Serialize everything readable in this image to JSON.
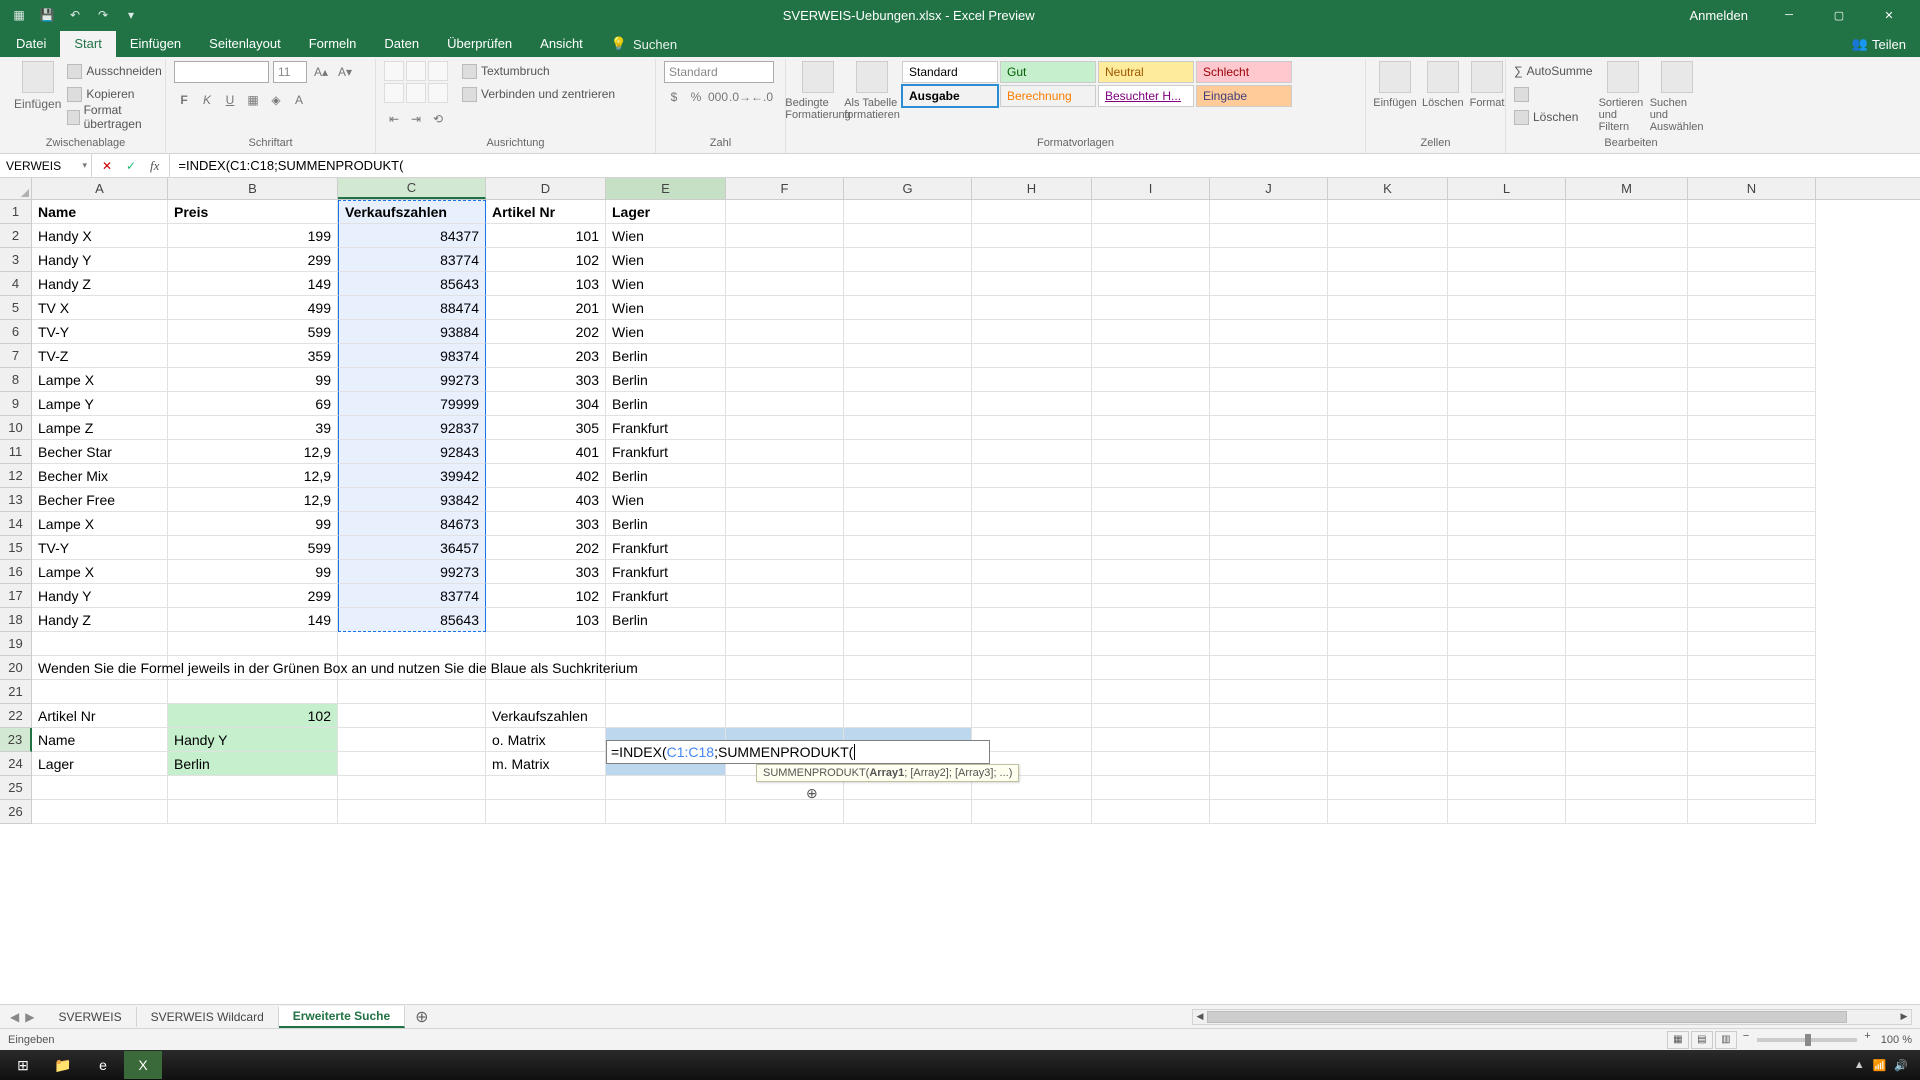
{
  "title": "SVERWEIS-Uebungen.xlsx - Excel Preview",
  "titlebar": {
    "anmelden": "Anmelden",
    "teilen": "Teilen"
  },
  "ribbon_tabs": [
    "Datei",
    "Start",
    "Einfügen",
    "Seitenlayout",
    "Formeln",
    "Daten",
    "Überprüfen",
    "Ansicht"
  ],
  "ribbon_tabs_active": 1,
  "search_label": "Suchen",
  "ribbon": {
    "clipboard": {
      "einfugen": "Einfügen",
      "ausschneiden": "Ausschneiden",
      "kopieren": "Kopieren",
      "format": "Format übertragen",
      "group": "Zwischenablage"
    },
    "font": {
      "name": "",
      "size": "11",
      "group": "Schriftart"
    },
    "align": {
      "textumbruch": "Textumbruch",
      "verbinden": "Verbinden und zentrieren",
      "group": "Ausrichtung"
    },
    "number": {
      "format": "Standard",
      "group": "Zahl"
    },
    "styles": {
      "bedingte": "Bedingte Formatierung",
      "tabelle": "Als Tabelle formatieren",
      "standard": "Standard",
      "gut": "Gut",
      "neutral": "Neutral",
      "schlecht": "Schlecht",
      "ausgabe": "Ausgabe",
      "berechnung": "Berechnung",
      "besuchter": "Besuchter H...",
      "eingabe": "Eingabe",
      "group": "Formatvorlagen"
    },
    "cells": {
      "einfugen": "Einfügen",
      "loschen": "Löschen",
      "format": "Format",
      "group": "Zellen"
    },
    "editing": {
      "autosumme": "AutoSumme",
      "loschen": "Löschen",
      "sortieren": "Sortieren und Filtern",
      "suchen": "Suchen und Auswählen",
      "group": "Bearbeiten"
    }
  },
  "name_box": "VERWEIS",
  "formula_bar": "=INDEX(C1:C18;SUMMENPRODUKT(",
  "columns": [
    "A",
    "B",
    "C",
    "D",
    "E",
    "F",
    "G",
    "H",
    "I",
    "J",
    "K",
    "L",
    "M",
    "N"
  ],
  "rows": [
    {
      "A": "Name",
      "B": "Preis",
      "C": "Verkaufszahlen",
      "D": "Artikel Nr",
      "E": "Lager"
    },
    {
      "A": "Handy X",
      "B": "199",
      "C": "84377",
      "D": "101",
      "E": "Wien"
    },
    {
      "A": "Handy Y",
      "B": "299",
      "C": "83774",
      "D": "102",
      "E": "Wien"
    },
    {
      "A": "Handy Z",
      "B": "149",
      "C": "85643",
      "D": "103",
      "E": "Wien"
    },
    {
      "A": "TV X",
      "B": "499",
      "C": "88474",
      "D": "201",
      "E": "Wien"
    },
    {
      "A": "TV-Y",
      "B": "599",
      "C": "93884",
      "D": "202",
      "E": "Wien"
    },
    {
      "A": "TV-Z",
      "B": "359",
      "C": "98374",
      "D": "203",
      "E": "Berlin"
    },
    {
      "A": "Lampe X",
      "B": "99",
      "C": "99273",
      "D": "303",
      "E": "Berlin"
    },
    {
      "A": "Lampe Y",
      "B": "69",
      "C": "79999",
      "D": "304",
      "E": "Berlin"
    },
    {
      "A": "Lampe Z",
      "B": "39",
      "C": "92837",
      "D": "305",
      "E": "Frankfurt"
    },
    {
      "A": "Becher Star",
      "B": "12,9",
      "C": "92843",
      "D": "401",
      "E": "Frankfurt"
    },
    {
      "A": "Becher Mix",
      "B": "12,9",
      "C": "39942",
      "D": "402",
      "E": "Berlin"
    },
    {
      "A": "Becher Free",
      "B": "12,9",
      "C": "93842",
      "D": "403",
      "E": "Wien"
    },
    {
      "A": "Lampe X",
      "B": "99",
      "C": "84673",
      "D": "303",
      "E": "Berlin"
    },
    {
      "A": "TV-Y",
      "B": "599",
      "C": "36457",
      "D": "202",
      "E": "Frankfurt"
    },
    {
      "A": "Lampe X",
      "B": "99",
      "C": "99273",
      "D": "303",
      "E": "Frankfurt"
    },
    {
      "A": "Handy Y",
      "B": "299",
      "C": "83774",
      "D": "102",
      "E": "Frankfurt"
    },
    {
      "A": "Handy Z",
      "B": "149",
      "C": "85643",
      "D": "103",
      "E": "Berlin"
    }
  ],
  "row20": "Wenden Sie die Formel jeweils in der Grünen Box an und nutzen Sie die Blaue als Suchkriterium",
  "lookup": {
    "r22": {
      "A": "Artikel Nr",
      "B": "102",
      "D": "Verkaufszahlen"
    },
    "r23": {
      "A": "Name",
      "B": "Handy Y",
      "D": "o. Matrix",
      "E": "=INDEX(C1:C18;SUMMENPRODUKT("
    },
    "r24": {
      "A": "Lager",
      "B": "Berlin",
      "D": "m. Matrix"
    }
  },
  "tooltip": {
    "fn": "SUMMENPRODUKT(",
    "args": "Array1; [Array2]; [Array3]; ...)",
    "bold_arg": "Array1"
  },
  "sheets": [
    "SVERWEIS",
    "SVERWEIS Wildcard",
    "Erweiterte Suche"
  ],
  "active_sheet": 2,
  "status": {
    "mode": "Eingeben",
    "zoom": "100 %"
  }
}
